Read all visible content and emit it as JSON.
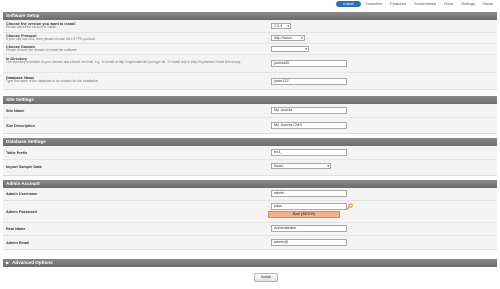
{
  "nav": {
    "tabs": [
      "Install",
      "Overview",
      "Features",
      "Screenshots",
      "Docs",
      "Ratings",
      "News"
    ]
  },
  "software_setup": {
    "title": "Software Setup",
    "version": {
      "label": "Choose the version you want to install",
      "sub": "Please select the version to install.",
      "value": "2.5.4"
    },
    "protocol": {
      "label": "Choose Protocol",
      "sub": "If your site has SSL, then please choose the HTTPS protocol.",
      "value": "http://www."
    },
    "domain": {
      "label": "Choose Domain",
      "sub": "Please choose the domain to install the software.",
      "value": ""
    },
    "directory": {
      "label": "In Directory",
      "sub": "The directory is relative to your domain and should not exist. e.g. To install at http://mydomain/dir/ just type dir. To install only in http://mydomain/ leave this empty.",
      "value": "joomla30"
    },
    "database": {
      "label": "Database Name",
      "sub": "Type the name of the database to be created for the installation",
      "value": "joom122"
    }
  },
  "site_settings": {
    "title": "Site Settings",
    "site_name": {
      "label": "Site Name",
      "value": "My Joomla"
    },
    "site_desc": {
      "label": "Site Description",
      "value": "My Joomla CMS"
    }
  },
  "database_settings": {
    "title": "Database Settings",
    "prefix": {
      "label": "Table Prefix",
      "value": "tm3_"
    },
    "sample": {
      "label": "Import Sample Data",
      "value": "None"
    }
  },
  "admin_account": {
    "title": "Admin Account",
    "username": {
      "label": "Admin Username",
      "value": "admin"
    },
    "password": {
      "label": "Admin Password",
      "value": "pass",
      "strength": "Bad (38/100)"
    },
    "realname": {
      "label": "Real Name",
      "value": "Administrator"
    },
    "email": {
      "label": "Admin Email",
      "value": "admin@"
    }
  },
  "advanced": {
    "title": "Advanced Options"
  },
  "install_button": "Install"
}
